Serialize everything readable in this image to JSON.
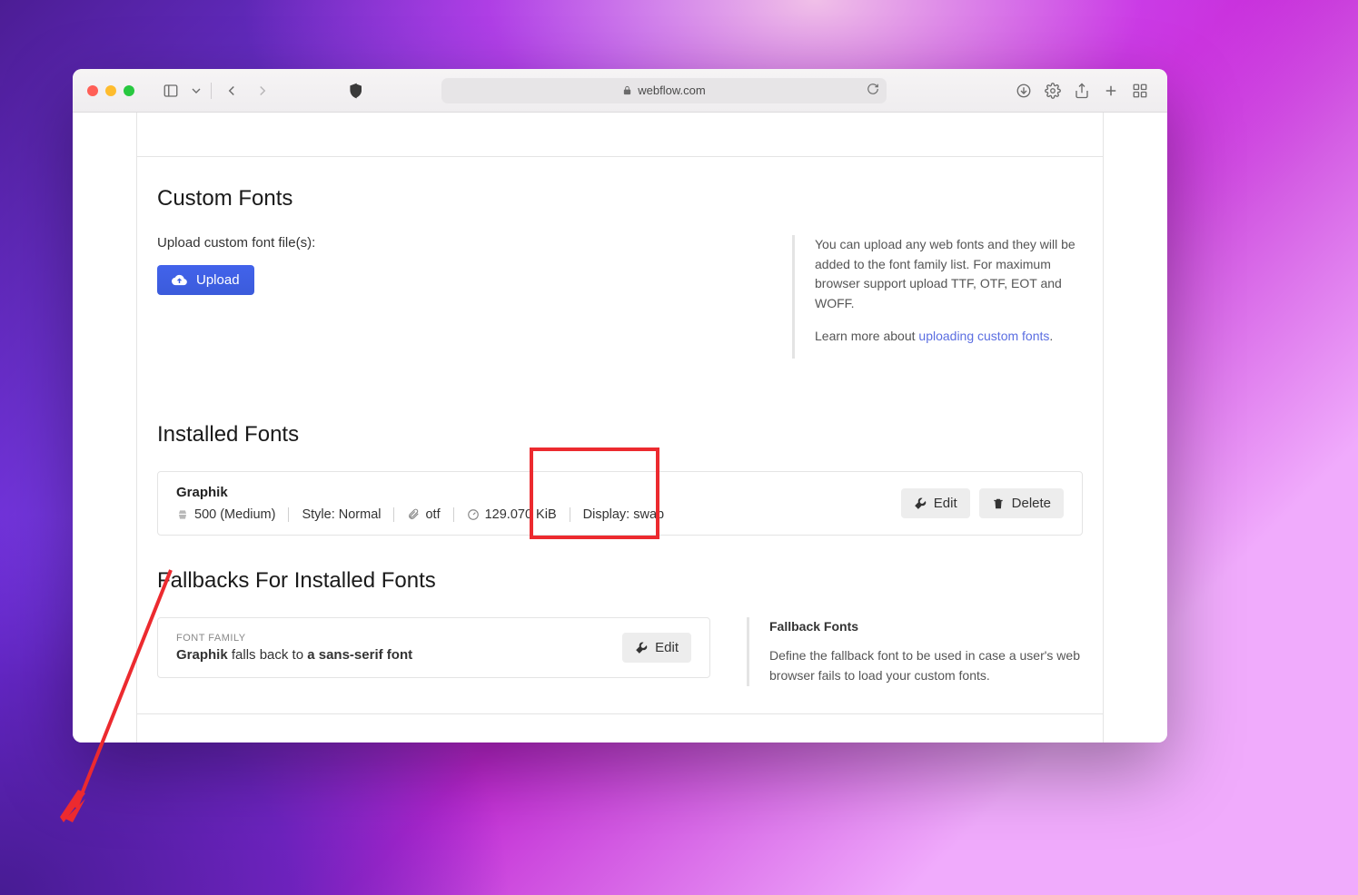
{
  "browser": {
    "url_host": "webflow.com"
  },
  "sections": {
    "custom_fonts": {
      "title": "Custom Fonts",
      "upload_label": "Upload custom font file(s):",
      "upload_button": "Upload",
      "help_text": "You can upload any web fonts and they will be added to the font family list. For maximum browser support upload TTF, OTF, EOT and WOFF.",
      "help_more_prefix": "Learn more about ",
      "help_link": "uploading custom fonts",
      "help_more_suffix": "."
    },
    "installed_fonts": {
      "title": "Installed Fonts",
      "font": {
        "name": "Graphik",
        "weight": "500 (Medium)",
        "style": "Style: Normal",
        "format": "otf",
        "size": "129.070 KiB",
        "display": "Display: swap"
      },
      "edit_button": "Edit",
      "delete_button": "Delete"
    },
    "fallbacks": {
      "title": "Fallbacks For Installed Fonts",
      "label": "FONT FAMILY",
      "font_name": "Graphik",
      "falls_back_text": " falls back to ",
      "fallback_value": "a sans-serif font",
      "edit_button": "Edit",
      "help_title": "Fallback Fonts",
      "help_text": "Define the fallback font to be used in case a user's web browser fails to load your custom fonts."
    }
  }
}
